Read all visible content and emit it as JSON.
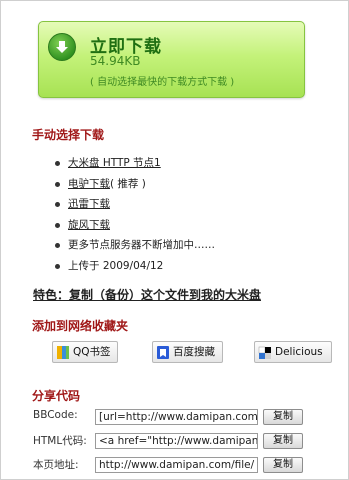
{
  "download": {
    "title": "立即下载",
    "size": "54.94KB",
    "note": "( 自动选择最快的下载方式下载 )"
  },
  "manual": {
    "heading": "手动选择下载",
    "items": [
      "大米盘 HTTP 节点1",
      "电驴下载",
      "( 推荐 )",
      "迅雷下载",
      "旋风下载",
      "更多节点服务器不断增加中……",
      "上传于 2009/04/12"
    ]
  },
  "feature": {
    "text": "特色：复制（备份）这个文件到我的大米盘"
  },
  "bookmarks": {
    "heading": "添加到网络收藏夹",
    "qq": "QQ书签",
    "baidu": "百度搜藏",
    "delicious": "Delicious"
  },
  "share": {
    "heading": "分享代码",
    "bbcode_label": "BBCode:",
    "bbcode_value": "[url=http://www.damipan.com",
    "html_label": "HTML代码:",
    "html_value": "<a href=\"http://www.damipan",
    "url_label": "本页地址:",
    "url_value": "http://www.damipan.com/file/",
    "copy_label": "复制"
  },
  "colors": {
    "accent_red": "#a01818",
    "button_green": "#a7e253",
    "title_green": "#1f6f12"
  },
  "icons": [
    "download-arrow-icon",
    "qq-bookmark-icon",
    "baidu-bookmark-icon",
    "delicious-icon"
  ]
}
